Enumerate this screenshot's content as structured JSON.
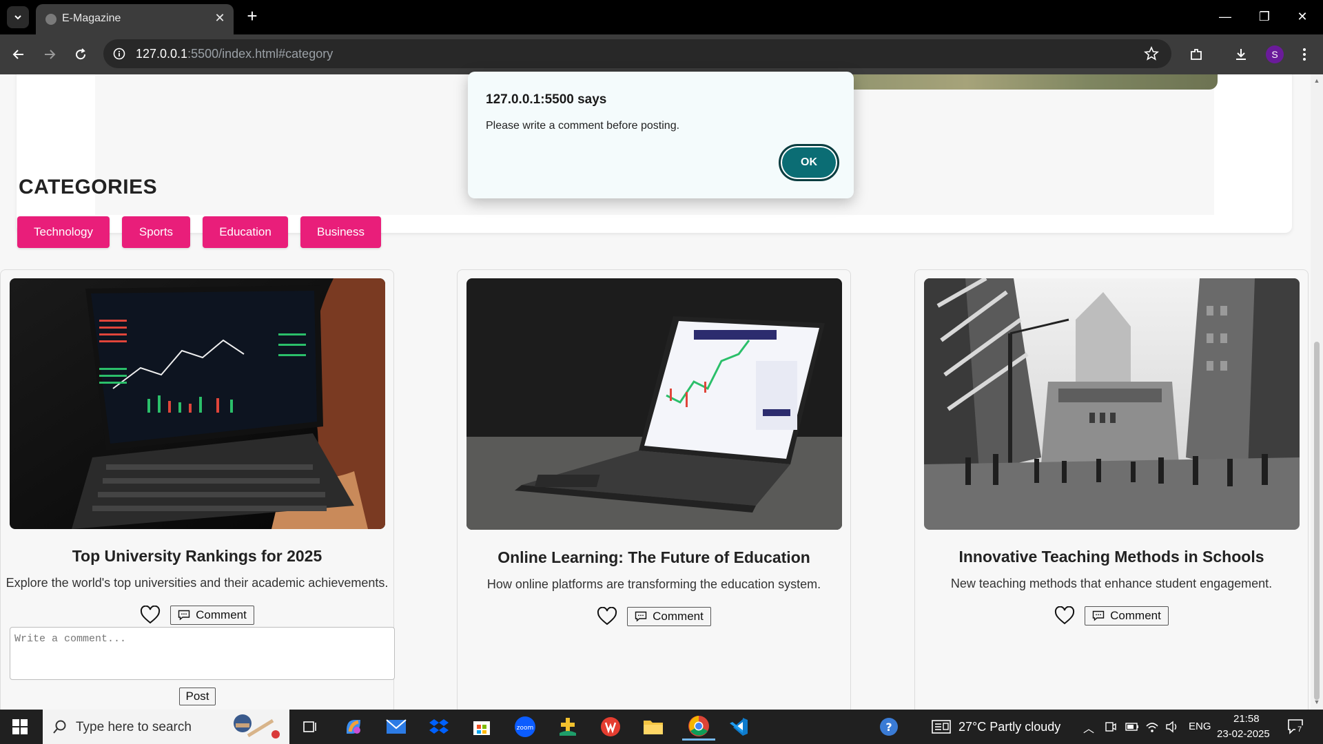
{
  "browser": {
    "tab_title": "E-Magazine",
    "url_host": "127.0.0.1",
    "url_rest": ":5500/index.html#category",
    "profile_initial": "S"
  },
  "dialog": {
    "title": "127.0.0.1:5500 says",
    "message": "Please write a comment before posting.",
    "ok_label": "OK"
  },
  "page": {
    "categories_title": "CATEGORIES",
    "categories": [
      "Technology",
      "Sports",
      "Education",
      "Business"
    ],
    "category_color": "#e91e7a",
    "articles": [
      {
        "title": "Top University Rankings for 2025",
        "description": "Explore the world's top universities and their academic achievements.",
        "comment_label": "Comment",
        "image": "tablet-trading-chart"
      },
      {
        "title": "Online Learning: The Future of Education",
        "description": "How online platforms are transforming the education system.",
        "comment_label": "Comment",
        "image": "laptop-dashboard"
      },
      {
        "title": "Innovative Teaching Methods in Schools",
        "description": "New teaching methods that enhance student engagement.",
        "comment_label": "Comment",
        "image": "city-street-bw"
      }
    ],
    "comment_placeholder": "Write a comment...",
    "post_label": "Post"
  },
  "taskbar": {
    "search_placeholder": "Type here to search",
    "weather": "27°C  Partly cloudy",
    "language": "ENG",
    "time": "21:58",
    "date": "23-02-2025",
    "notification_count": "7"
  }
}
